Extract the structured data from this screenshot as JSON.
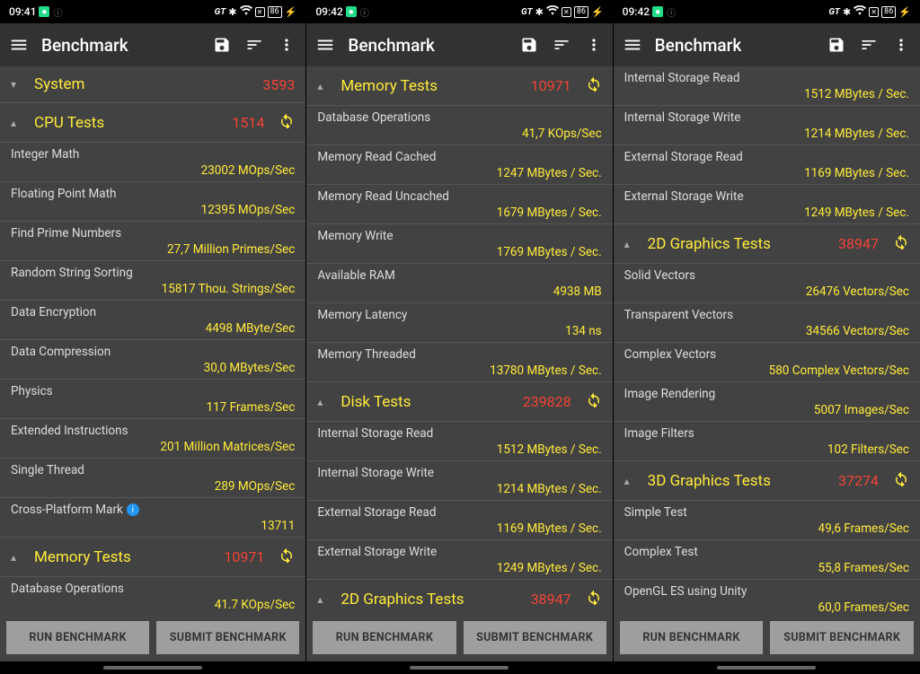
{
  "panels": [
    {
      "statusbar": {
        "time": "09:41",
        "battery": "86"
      },
      "appbar": {
        "title": "Benchmark"
      },
      "blocks": [
        {
          "type": "section",
          "chev": "down",
          "name": "System",
          "score": "3593",
          "reload": false
        },
        {
          "type": "section",
          "chev": "up",
          "name": "CPU Tests",
          "score": "1514",
          "reload": true
        },
        {
          "type": "row",
          "label": "Integer Math",
          "value": "23002 MOps/Sec"
        },
        {
          "type": "row",
          "label": "Floating Point Math",
          "value": "12395 MOps/Sec"
        },
        {
          "type": "row",
          "label": "Find Prime Numbers",
          "value": "27,7 Million Primes/Sec"
        },
        {
          "type": "row",
          "label": "Random String Sorting",
          "value": "15817 Thou. Strings/Sec"
        },
        {
          "type": "row",
          "label": "Data Encryption",
          "value": "4498 MByte/Sec"
        },
        {
          "type": "row",
          "label": "Data Compression",
          "value": "30,0 MBytes/Sec"
        },
        {
          "type": "row",
          "label": "Physics",
          "value": "117 Frames/Sec"
        },
        {
          "type": "row",
          "label": "Extended Instructions",
          "value": "201 Million Matrices/Sec"
        },
        {
          "type": "row",
          "label": "Single Thread",
          "value": "289 MOps/Sec"
        },
        {
          "type": "row",
          "label": "Cross-Platform Mark",
          "value": "13711",
          "info": true
        },
        {
          "type": "section",
          "chev": "up",
          "name": "Memory Tests",
          "score": "10971",
          "reload": true
        },
        {
          "type": "row",
          "label": "Database Operations",
          "value": "41.7 KOps/Sec"
        }
      ],
      "buttons": {
        "run": "RUN BENCHMARK",
        "submit": "SUBMIT BENCHMARK"
      }
    },
    {
      "statusbar": {
        "time": "09:42",
        "battery": "86"
      },
      "appbar": {
        "title": "Benchmark"
      },
      "blocks": [
        {
          "type": "section",
          "chev": "up",
          "name": "Memory Tests",
          "score": "10971",
          "reload": true
        },
        {
          "type": "row",
          "label": "Database Operations",
          "value": "41,7 KOps/Sec"
        },
        {
          "type": "row",
          "label": "Memory Read Cached",
          "value": "1247 MBytes / Sec."
        },
        {
          "type": "row",
          "label": "Memory Read Uncached",
          "value": "1679 MBytes / Sec."
        },
        {
          "type": "row",
          "label": "Memory Write",
          "value": "1769 MBytes / Sec."
        },
        {
          "type": "row",
          "label": "Available RAM",
          "value": "4938 MB"
        },
        {
          "type": "row",
          "label": "Memory Latency",
          "value": "134 ns"
        },
        {
          "type": "row",
          "label": "Memory Threaded",
          "value": "13780 MBytes / Sec."
        },
        {
          "type": "section",
          "chev": "up",
          "name": "Disk Tests",
          "score": "239828",
          "reload": true
        },
        {
          "type": "row",
          "label": "Internal Storage Read",
          "value": "1512 MBytes / Sec."
        },
        {
          "type": "row",
          "label": "Internal Storage Write",
          "value": "1214 MBytes / Sec."
        },
        {
          "type": "row",
          "label": "External Storage Read",
          "value": "1169 MBytes / Sec."
        },
        {
          "type": "row",
          "label": "External Storage Write",
          "value": "1249 MBytes / Sec."
        },
        {
          "type": "section",
          "chev": "up",
          "name": "2D Graphics Tests",
          "score": "38947",
          "reload": true
        }
      ],
      "buttons": {
        "run": "RUN BENCHMARK",
        "submit": "SUBMIT BENCHMARK"
      }
    },
    {
      "statusbar": {
        "time": "09:42",
        "battery": "86"
      },
      "appbar": {
        "title": "Benchmark"
      },
      "blocks": [
        {
          "type": "row",
          "label": "Internal Storage Read",
          "value": "1512 MBytes / Sec."
        },
        {
          "type": "row",
          "label": "Internal Storage Write",
          "value": "1214 MBytes / Sec."
        },
        {
          "type": "row",
          "label": "External Storage Read",
          "value": "1169 MBytes / Sec."
        },
        {
          "type": "row",
          "label": "External Storage Write",
          "value": "1249 MBytes / Sec."
        },
        {
          "type": "section",
          "chev": "up",
          "name": "2D Graphics Tests",
          "score": "38947",
          "reload": true
        },
        {
          "type": "row",
          "label": "Solid Vectors",
          "value": "26476 Vectors/Sec"
        },
        {
          "type": "row",
          "label": "Transparent Vectors",
          "value": "34566 Vectors/Sec"
        },
        {
          "type": "row",
          "label": "Complex Vectors",
          "value": "580 Complex Vectors/Sec"
        },
        {
          "type": "row",
          "label": "Image Rendering",
          "value": "5007 Images/Sec"
        },
        {
          "type": "row",
          "label": "Image Filters",
          "value": "102 Filters/Sec"
        },
        {
          "type": "section",
          "chev": "up",
          "name": "3D Graphics Tests",
          "score": "37274",
          "reload": true
        },
        {
          "type": "row",
          "label": "Simple Test",
          "value": "49,6 Frames/Sec"
        },
        {
          "type": "row",
          "label": "Complex Test",
          "value": "55,8 Frames/Sec"
        },
        {
          "type": "row",
          "label": "OpenGL ES using Unity",
          "value": "60,0 Frames/Sec"
        }
      ],
      "buttons": {
        "run": "RUN BENCHMARK",
        "submit": "SUBMIT BENCHMARK"
      }
    }
  ]
}
